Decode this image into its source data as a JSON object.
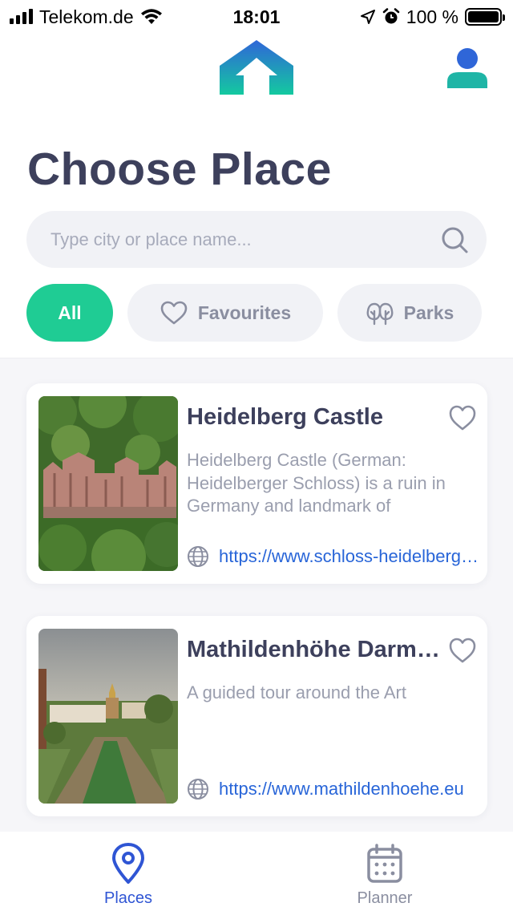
{
  "status_bar": {
    "carrier": "Telekom.de",
    "time": "18:01",
    "battery": "100 %"
  },
  "header": {
    "logo_icon": "home-arrow-logo",
    "profile_icon": "user-profile-icon"
  },
  "page": {
    "title": "Choose Place"
  },
  "search": {
    "placeholder": "Type city or place name...",
    "value": ""
  },
  "filters": [
    {
      "label": "All",
      "icon": null,
      "active": true
    },
    {
      "label": "Favourites",
      "icon": "heart-icon",
      "active": false
    },
    {
      "label": "Parks",
      "icon": "trees-icon",
      "active": false
    }
  ],
  "places": [
    {
      "title": "Heidelberg Castle",
      "description": "Heidelberg Castle (German: Heidelberger Schloss) is a ruin in Germany and landmark of",
      "url": "https://www.schloss-heidelberg.de",
      "favourite": false
    },
    {
      "title": "Mathildenhöhe Darmstadt",
      "description": "A guided tour around the Art",
      "url": "https://www.mathildenhoehe.eu",
      "favourite": false
    }
  ],
  "tabs": [
    {
      "label": "Places",
      "icon": "map-pin-icon",
      "active": true
    },
    {
      "label": "Planner",
      "icon": "calendar-icon",
      "active": false
    }
  ],
  "colors": {
    "accent_green": "#1fcc94",
    "title_dark": "#3d405c",
    "link_blue": "#2865d8",
    "active_tab_blue": "#2f55d4"
  }
}
